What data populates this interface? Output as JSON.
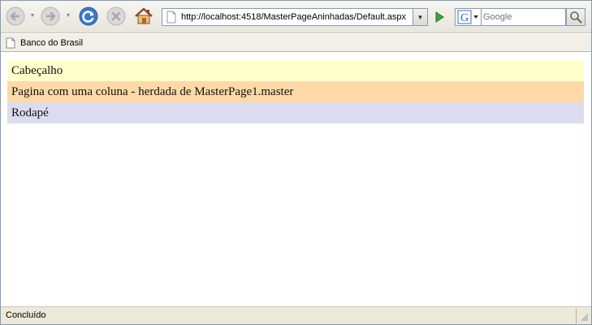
{
  "toolbar": {
    "url": "http://localhost:4518/MasterPageAninhadas/Default.aspx",
    "search_placeholder": "Google"
  },
  "bookmarks": [
    {
      "label": "Banco do Brasil"
    }
  ],
  "content": {
    "header": "Cabeçalho",
    "body": "Pagina com uma coluna - herdada de MasterPage1.master",
    "footer": "Rodapé"
  },
  "status": {
    "text": "Concluído"
  },
  "colors": {
    "header_bg": "#ffffcc",
    "body_bg": "#fdd9a8",
    "footer_bg": "#dcdcee"
  }
}
